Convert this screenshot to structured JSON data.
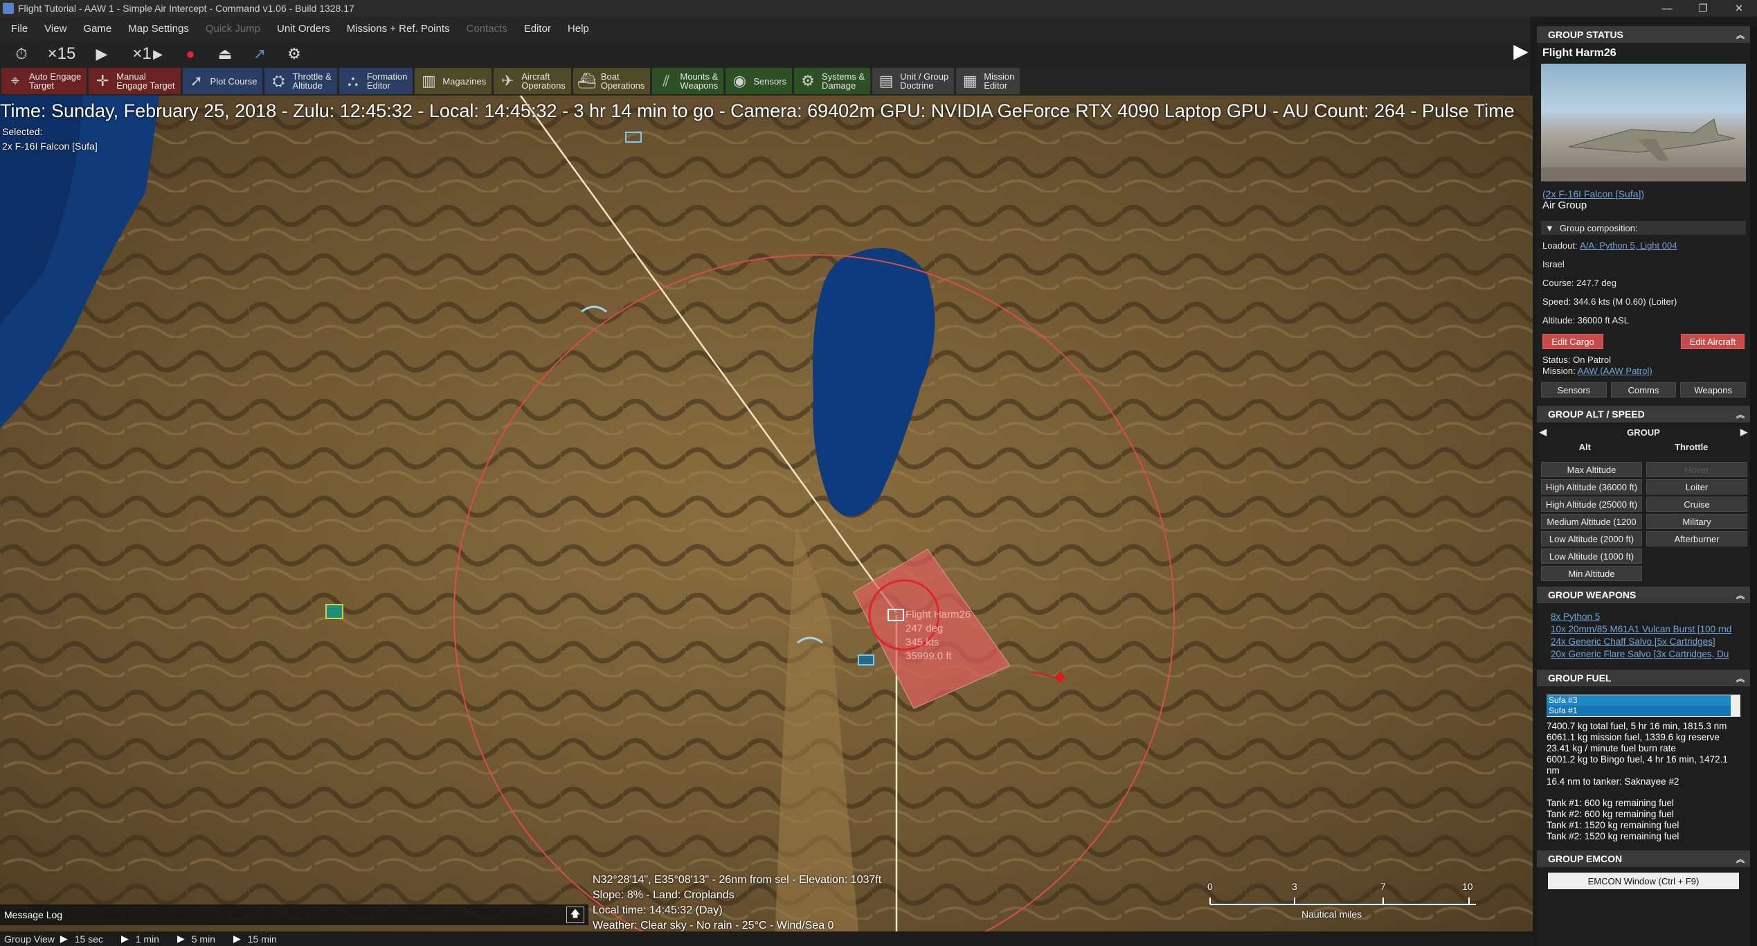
{
  "window": {
    "title": "Flight Tutorial - AAW 1 - Simple Air Intercept - Command v1.06 - Build 1328.17",
    "controls": [
      "—",
      "❐",
      "✕"
    ]
  },
  "menu": [
    "File",
    "View",
    "Game",
    "Map Settings",
    "Quick Jump",
    "Unit Orders",
    "Missions + Ref. Points",
    "Contacts",
    "Editor",
    "Help"
  ],
  "time_controls": {
    "compression_label": "×15",
    "speed_label": "×1"
  },
  "toolbar": [
    {
      "label": "Auto Engage\nTarget",
      "icon": "crosshair-icon",
      "color": "#6b2222"
    },
    {
      "label": "Manual\nEngage Target",
      "icon": "target-icon",
      "color": "#6b2222"
    },
    {
      "label": "Plot Course",
      "icon": "course-icon",
      "color": "#2a3e63"
    },
    {
      "label": "Throttle &\nAltitude",
      "icon": "throttle-icon",
      "color": "#2a3e63"
    },
    {
      "label": "Formation\nEditor",
      "icon": "formation-icon",
      "color": "#2a3e63"
    },
    {
      "label": "Magazines",
      "icon": "magazine-icon",
      "color": "#4e4a25"
    },
    {
      "label": "Aircraft\nOperations",
      "icon": "aircraft-icon",
      "color": "#4e4a25"
    },
    {
      "label": "Boat\nOperations",
      "icon": "boat-icon",
      "color": "#4e4a25"
    },
    {
      "label": "Mounts &\nWeapons",
      "icon": "weapons-icon",
      "color": "#2d5125"
    },
    {
      "label": "Sensors",
      "icon": "sensor-icon",
      "color": "#2d5125"
    },
    {
      "label": "Systems &\nDamage",
      "icon": "systems-icon",
      "color": "#2d5125"
    },
    {
      "label": "Unit / Group\nDoctrine",
      "icon": "doctrine-icon",
      "color": "#3d3d3d"
    },
    {
      "label": "Mission\nEditor",
      "icon": "mission-icon",
      "color": "#3d3d3d"
    }
  ],
  "map": {
    "info_line": "Time: Sunday, February 25, 2018 - Zulu: 12:45:32 - Local: 14:45:32 - 3 hr 14 min to go -  Camera: 69402m  GPU: NVIDIA GeForce RTX 4090 Laptop GPU - AU Count: 264 - Pulse Time",
    "selected_label": "Selected:",
    "selected_unit": "2x F-16I Falcon [Sufa]",
    "unit_label": {
      "name": "Flight Harm26",
      "course": "247 deg",
      "speed": "345 kts",
      "altitude": "35999.0 ft"
    },
    "cursor_info": [
      "N32°28'14\", E35°08'13\" - 26nm from sel - Elevation: 1037ft",
      "Slope: 8%  - Land: Croplands",
      "Local time: 14:45:32 (Day)",
      "Weather: Clear sky - No rain - 25°C - Wind/Sea 0"
    ],
    "scale": {
      "ticks": [
        "0",
        "3",
        "7",
        "10"
      ],
      "unit": "Nautical miles"
    },
    "message_log": "Message Log"
  },
  "bottom_bar": {
    "view_label": "Group View",
    "steps": [
      "15 sec",
      "1 min",
      "5 min",
      "15 min"
    ]
  },
  "panel": {
    "group_status": {
      "header": "GROUP STATUS",
      "name": "Flight Harm26",
      "unit_link": "(2x F-16I Falcon [Sufa])",
      "unit_type": "Air Group",
      "composition": "Group composition:",
      "loadout_label": "Loadout:",
      "loadout_value": "A/A: Python 5, Light 004",
      "side": "Israel",
      "course": "Course: 247.7 deg",
      "speed": "Speed: 344.6 kts (M 0.60) (Loiter)",
      "altitude": "Altitude: 36000 ft ASL",
      "edit_cargo": "Edit Cargo",
      "edit_aircraft": "Edit Aircraft",
      "status": "Status: On Patrol",
      "mission_label": "Mission:",
      "mission_value": "AAW (AAW Patrol)",
      "tabs": [
        "Sensors",
        "Comms",
        "Weapons"
      ]
    },
    "alt_speed": {
      "header": "GROUP ALT / SPEED",
      "group": "GROUP",
      "alt_col": "Alt",
      "throttle_col": "Throttle",
      "altitudes": [
        "Max Altitude",
        "High Altitude (36000 ft)",
        "High Altitude (25000 ft)",
        "Medium Altitude (1200",
        "Low Altitude (2000 ft)",
        "Low Altitude (1000 ft)",
        "Min Altitude"
      ],
      "throttles": [
        "Hover",
        "Loiter",
        "Cruise",
        "Military",
        "Afterburner"
      ]
    },
    "weapons": {
      "header": "GROUP WEAPONS",
      "items": [
        "8x Python 5",
        "10x 20mm/85 M61A1 Vulcan Burst [100 rnd",
        "24x Generic Chaff Salvo [5x Cartridges]",
        "20x Generic Flare Salvo [3x Cartridges, Du"
      ]
    },
    "fuel": {
      "header": "GROUP FUEL",
      "bars": [
        {
          "label": "Sufa #3",
          "fraction": 0.95
        },
        {
          "label": "Sufa #1",
          "fraction": 0.95
        }
      ],
      "lines": [
        "7400.7 kg total fuel, 5 hr 16 min, 1815.3 nm",
        "6061.1 kg mission fuel, 1339.6 kg reserve",
        "23.41 kg / minute fuel burn rate",
        "6001.2 kg to Bingo fuel, 4 hr 16 min, 1472.1",
        "nm",
        "16.4 nm to tanker: Saknayee #2",
        "",
        "Tank #1: 600 kg remaining fuel",
        "Tank #2: 600 kg remaining fuel",
        "Tank #1: 1520 kg remaining fuel",
        "Tank #2: 1520 kg remaining fuel"
      ]
    },
    "emcon": {
      "header": "GROUP EMCON",
      "button": "EMCON Window (Ctrl + F9)"
    }
  }
}
